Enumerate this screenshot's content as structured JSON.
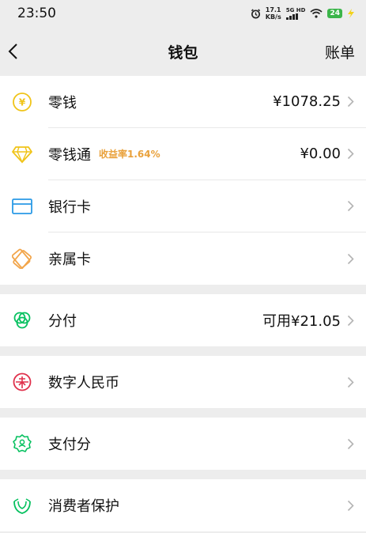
{
  "status": {
    "time": "23:50",
    "net_speed_value": "17.1",
    "net_speed_unit": "KB/s",
    "signal_label": "5G HD",
    "battery": "24"
  },
  "nav": {
    "title": "钱包",
    "bill_label": "账单"
  },
  "items": [
    {
      "label": "零钱",
      "value": "¥1078.25",
      "icon": "coin-icon",
      "color": "#f0c419"
    },
    {
      "label": "零钱通",
      "badge": "收益率1.64%",
      "value": "¥0.00",
      "icon": "diamond-icon",
      "color": "#f0c419"
    },
    {
      "label": "银行卡",
      "icon": "bank-card-icon",
      "color": "#2a9ae6"
    },
    {
      "label": "亲属卡",
      "icon": "family-card-icon",
      "color": "#f2a54a"
    },
    {
      "label": "分付",
      "value": "可用¥21.05",
      "icon": "fenfu-icon",
      "color": "#07c160"
    },
    {
      "label": "数字人民币",
      "icon": "digital-rmb-icon",
      "color": "#e0304b"
    },
    {
      "label": "支付分",
      "icon": "payscore-icon",
      "color": "#07c160"
    },
    {
      "label": "消费者保护",
      "icon": "consumer-protection-icon",
      "color": "#07c160"
    }
  ]
}
